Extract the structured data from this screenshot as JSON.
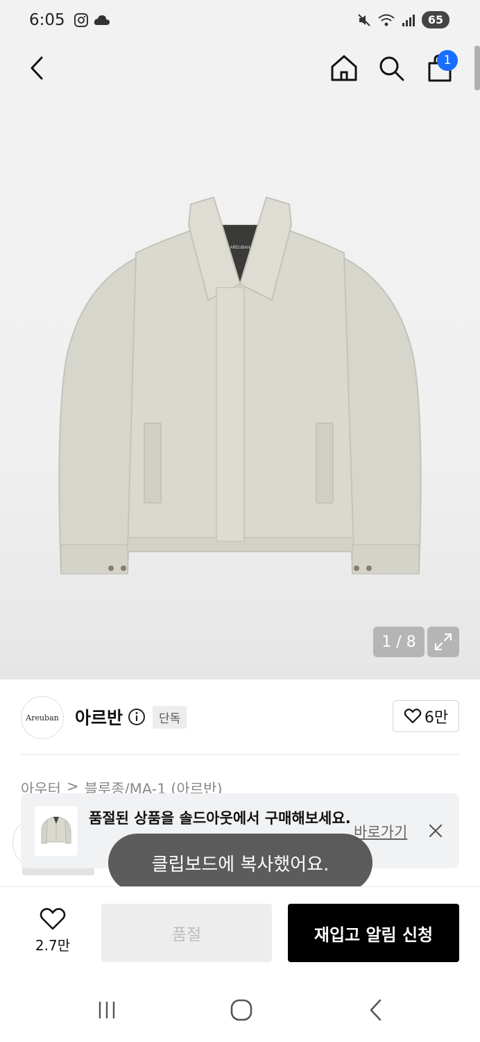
{
  "status_bar": {
    "time": "6:05",
    "battery": "65",
    "left_icons": [
      "instagram-icon",
      "weather-icon"
    ],
    "right_icons": [
      "mute-icon",
      "wifi-icon",
      "signal-icon"
    ]
  },
  "nav": {
    "cart_count": "1",
    "icons": [
      "back-arrow-icon",
      "home-icon",
      "search-icon",
      "cart-bag-icon"
    ],
    "badge_color": "#1a6dff"
  },
  "gallery": {
    "counter": "1 / 8",
    "brand_label_on_jacket": "AREUBAN"
  },
  "brand": {
    "logo_text": "Areuban",
    "name": "아르반",
    "tag": "단독",
    "likes": "6만"
  },
  "breadcrumb": {
    "items": [
      "아우터",
      "블루종/MA-1 (아르반)"
    ],
    "separator": ">"
  },
  "soldout_banner": {
    "message": "품절된 상품을 솔드아웃에서 구매해보세요.",
    "link": "바로가기"
  },
  "toast": {
    "message": "클립보드에 복사했어요."
  },
  "bottom_bar": {
    "wish_count": "2.7만",
    "soldout_label": "품절",
    "restock_label": "재입고 알림 신청"
  },
  "system_nav": {
    "icons": [
      "recent-apps-icon",
      "home-circle-icon",
      "back-chevron-icon"
    ]
  }
}
